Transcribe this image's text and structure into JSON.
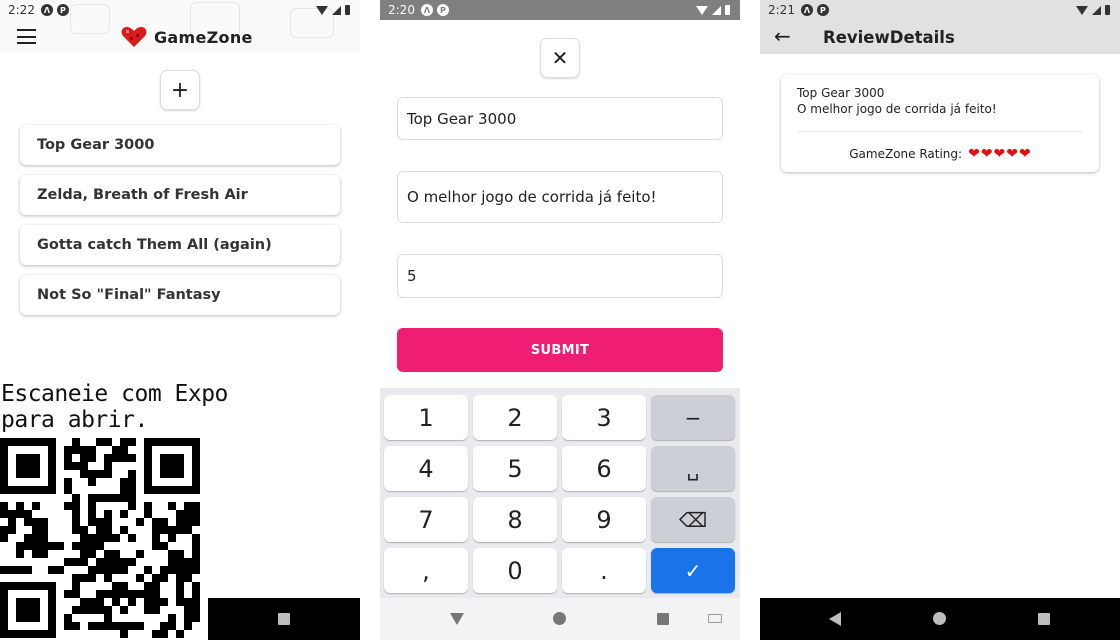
{
  "screen1": {
    "status": {
      "time": "2:22"
    },
    "app_title": "GameZone",
    "add_button_label": "+",
    "reviews": [
      {
        "title": "Top Gear 3000"
      },
      {
        "title": "Zelda, Breath of Fresh Air"
      },
      {
        "title": "Gotta catch Them All (again)"
      },
      {
        "title": "Not So \"Final\" Fantasy"
      }
    ],
    "qr_caption_line1": "Escaneie com Expo",
    "qr_caption_line2": "para abrir."
  },
  "screen2": {
    "status": {
      "time": "2:20"
    },
    "close_label": "✕",
    "title_value": "Top Gear 3000",
    "body_value": "O melhor jogo de corrida já feito!",
    "rating_value": "5",
    "submit_label": "SUBMIT",
    "keypad": [
      {
        "label": "1",
        "type": "digit"
      },
      {
        "label": "2",
        "type": "digit"
      },
      {
        "label": "3",
        "type": "digit"
      },
      {
        "label": "−",
        "type": "fn"
      },
      {
        "label": "4",
        "type": "digit"
      },
      {
        "label": "5",
        "type": "digit"
      },
      {
        "label": "6",
        "type": "digit"
      },
      {
        "label": "␣",
        "type": "fn"
      },
      {
        "label": "7",
        "type": "digit"
      },
      {
        "label": "8",
        "type": "digit"
      },
      {
        "label": "9",
        "type": "digit"
      },
      {
        "label": "⌫",
        "type": "fn"
      },
      {
        "label": ",",
        "type": "digit"
      },
      {
        "label": "0",
        "type": "digit"
      },
      {
        "label": ".",
        "type": "digit"
      },
      {
        "label": "✓",
        "type": "enter"
      }
    ]
  },
  "screen3": {
    "status": {
      "time": "2:21"
    },
    "header_title": "ReviewDetails",
    "review_title": "Top Gear 3000",
    "review_body": "O melhor jogo de corrida já feito!",
    "rating_label": "GameZone Rating:",
    "rating": 5,
    "heart_color": "#e01010"
  },
  "colors": {
    "submit": "#f01e72",
    "enter_key": "#1a73e8",
    "details_header": "#e1e1e1"
  }
}
